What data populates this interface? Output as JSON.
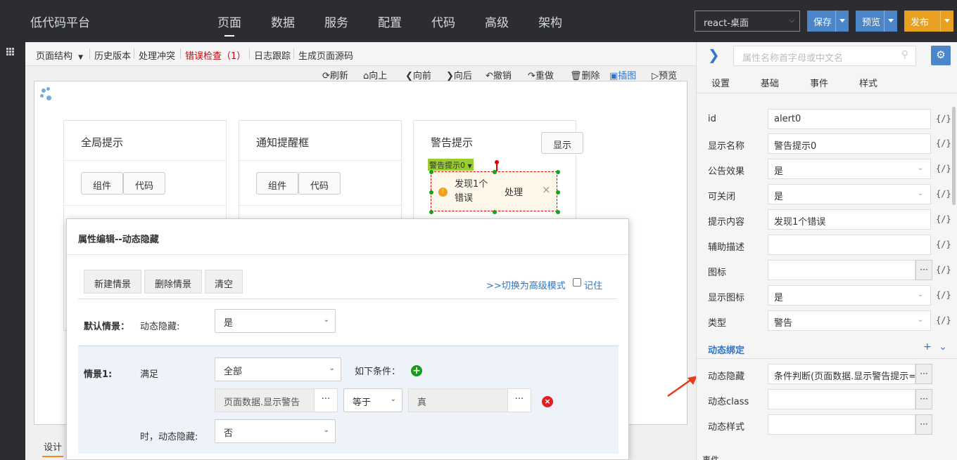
{
  "app": {
    "brand": "低代码平台"
  },
  "nav": {
    "items": [
      "页面",
      "数据",
      "服务",
      "配置",
      "代码",
      "高级",
      "架构"
    ],
    "active_index": 0
  },
  "top_actions": {
    "environment": "react-桌面",
    "save": "保存",
    "preview": "预览",
    "publish": "发布"
  },
  "sub_toolbar": {
    "items": [
      "页面结构",
      "历史版本",
      "处理冲突",
      "错误检查（1）",
      "日志跟踪",
      "生成页面源码"
    ]
  },
  "actions": [
    "刷新",
    "向上",
    "向前",
    "向后",
    "撤销",
    "重做",
    "删除",
    "插图",
    "预览"
  ],
  "canvas": {
    "cards": [
      {
        "title": "全局提示",
        "buttons": [
          "组件",
          "代码"
        ]
      },
      {
        "title": "通知提醒框",
        "buttons": [
          "组件",
          "代码"
        ]
      },
      {
        "title": "警告提示"
      }
    ],
    "show_button": "显示",
    "component_tag": "警告提示0",
    "alert": {
      "text": "发现1个错误",
      "action": "处理",
      "close": "×"
    },
    "design_tab": "设计"
  },
  "modal": {
    "title": "属性编辑--动态隐藏",
    "buttons": [
      "新建情景",
      "删除情景",
      "清空"
    ],
    "advanced_link": ">>切换为高级模式",
    "remember": "记住",
    "default_label": "默认情景：",
    "default_prop": "动态隐藏:",
    "default_value": "是",
    "scenario": {
      "label": "情景1:",
      "satisfy": "满足",
      "match": "全部",
      "condition_label": "如下条件：",
      "field": "页面数据.显示警告",
      "operator": "等于",
      "value": "真",
      "dots": "···",
      "when_label": "时，动态隐藏:",
      "when_value": "否"
    }
  },
  "right_panel": {
    "search_placeholder": "属性名称首字母或中文名",
    "tabs": [
      "设置",
      "基础",
      "事件",
      "样式"
    ],
    "code_marker": "{/}",
    "dots": "···",
    "rows": [
      {
        "label": "id",
        "value": "alert0"
      },
      {
        "label": "显示名称",
        "value": "警告提示0"
      },
      {
        "label": "公告效果",
        "value": "是"
      },
      {
        "label": "可关闭",
        "value": "是"
      },
      {
        "label": "提示内容",
        "value": "发现1个错误"
      },
      {
        "label": "辅助描述",
        "value": ""
      },
      {
        "label": "图标",
        "value": ""
      },
      {
        "label": "显示图标",
        "value": "是"
      },
      {
        "label": "类型",
        "value": "警告"
      }
    ],
    "section": "动态绑定",
    "dynamic_rows": [
      {
        "label": "动态隐藏",
        "value": "条件判断(页面数据.显示警告提示=="
      },
      {
        "label": "动态class",
        "value": ""
      },
      {
        "label": "动态样式",
        "value": ""
      }
    ],
    "bottom_label": "事件"
  },
  "colors": {
    "topbar": "#2b2d33",
    "save": "#4a86c8",
    "preview": "#4a86c8",
    "publish": "#e8a020",
    "error": "#d00000",
    "link": "#2f75c9"
  }
}
